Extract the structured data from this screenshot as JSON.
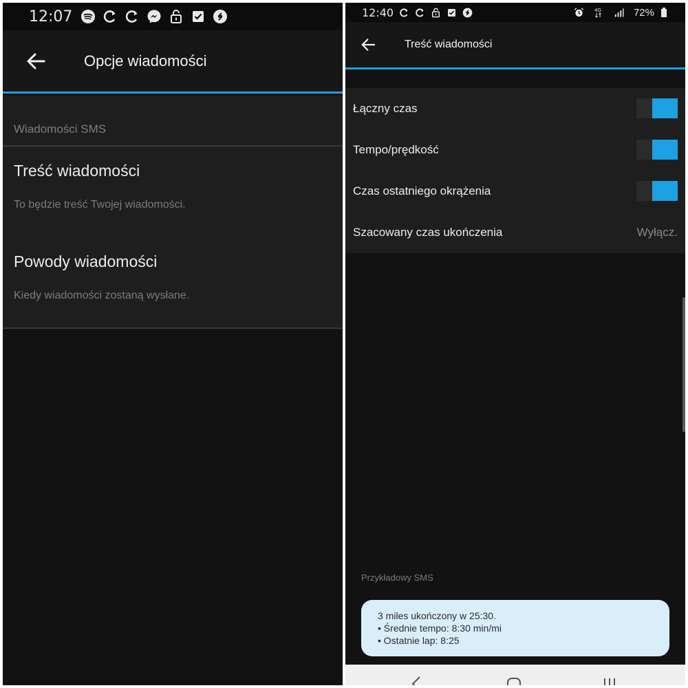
{
  "left": {
    "status_bar": {
      "time": "12:07",
      "icons": [
        "spotify-icon",
        "sync-icon",
        "sync-icon",
        "messenger-icon",
        "lock-icon",
        "checkbox-icon",
        "shazam-icon"
      ]
    },
    "header": {
      "title": "Opcje wiadomości",
      "back_icon": "arrow-left-icon"
    },
    "section_label": "Wiadomości SMS",
    "items": [
      {
        "title": "Treść wiadomości",
        "subtitle": "To będzie treść Twojej wiadomości."
      },
      {
        "title": "Powody wiadomości",
        "subtitle": "Kiedy wiadomości zostaną wysłane."
      }
    ]
  },
  "right": {
    "status_bar": {
      "time": "12:40",
      "icons": [
        "sync-icon",
        "sync-icon",
        "lock-icon",
        "checkbox-icon",
        "shazam-icon"
      ],
      "right_icons": [
        "alarm-icon",
        "4g-icon",
        "signal-icon",
        "battery-icon"
      ],
      "battery": "72%"
    },
    "header": {
      "title": "Treść wiadomości",
      "back_icon": "arrow-left-icon"
    },
    "toggles": [
      {
        "label": "Łączny czas",
        "on": true
      },
      {
        "label": "Tempo/prędkość",
        "on": true
      },
      {
        "label": "Czas ostatniego okrążenia",
        "on": true
      }
    ],
    "estimate_row": {
      "label": "Szacowany czas ukończenia",
      "value": "Wyłącz."
    },
    "sample_label": "Przykładowy SMS",
    "sample_lines": [
      "3 miles ukończony w 25:30.",
      "• Średnie tempo: 8:30 min/mi",
      "• Ostatnie lap: 8:25"
    ],
    "nav_icons": [
      "back-nav-icon",
      "home-nav-icon",
      "recents-nav-icon"
    ]
  },
  "colors": {
    "accent": "#1da1e2",
    "background": "#121212",
    "surface": "#1e1e1e",
    "bubble": "#d9eef9"
  }
}
